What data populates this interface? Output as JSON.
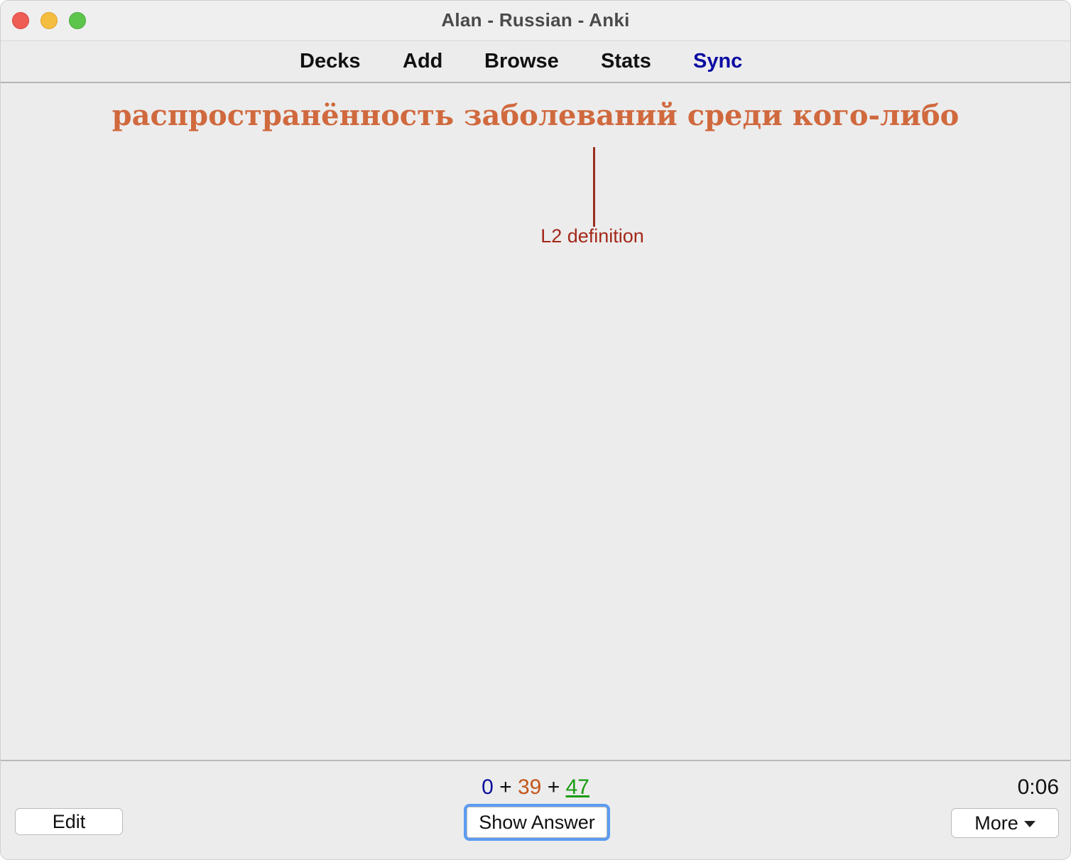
{
  "window": {
    "title": "Alan - Russian - Anki"
  },
  "toolbar": {
    "decks": "Decks",
    "add": "Add",
    "browse": "Browse",
    "stats": "Stats",
    "sync": "Sync",
    "sync_color": "#0b0ba3"
  },
  "card": {
    "front": "распространённость заболеваний среди кого-либо",
    "front_color": "#d0693e",
    "hint": "L2 definition",
    "hint_color": "#a4281a"
  },
  "bottom": {
    "count_new": "0",
    "count_learn": "39",
    "count_review": "47",
    "plus": "+",
    "timer": "0:06",
    "edit_label": "Edit",
    "show_answer_label": "Show Answer",
    "more_label": "More",
    "more_icon": "chevron-down-icon",
    "colors": {
      "new": "#0d0d9b",
      "learn": "#c3561b",
      "review": "#1a9c12"
    }
  }
}
